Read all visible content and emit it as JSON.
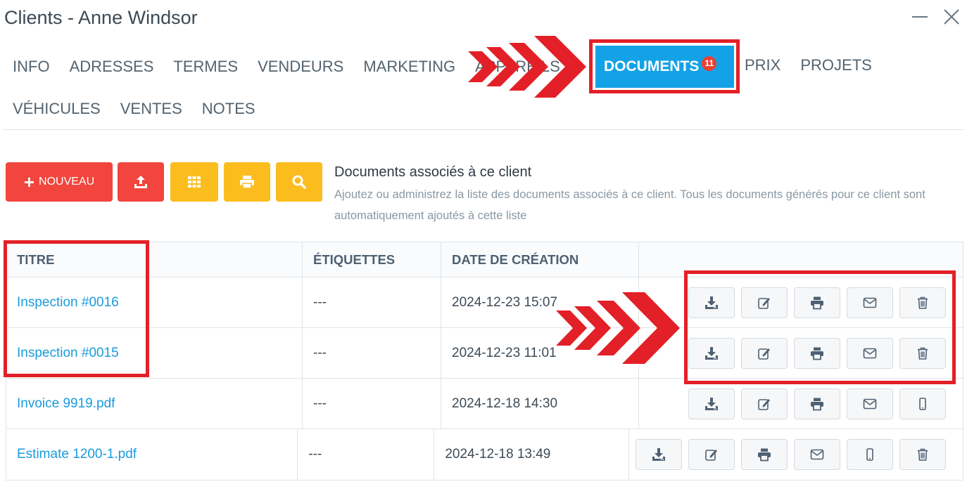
{
  "window": {
    "title": "Clients - Anne Windsor"
  },
  "tabs_row1": [
    "INFO",
    "ADRESSES",
    "TERMES",
    "VENDEURS",
    "MARKETING",
    "APPAREILS"
  ],
  "active_tab": {
    "label": "DOCUMENTS",
    "badge": "11"
  },
  "tabs_after": [
    "PRIX",
    "PROJETS"
  ],
  "tabs_row2": [
    "VÉHICULES",
    "VENTES",
    "NOTES"
  ],
  "toolbar": {
    "new_label": "NOUVEAU"
  },
  "section": {
    "heading": "Documents associés à ce client",
    "description": "Ajoutez ou administrez la liste des documents associés à ce client. Tous les documents générés pour ce client sont automatiquement ajoutés à cette liste"
  },
  "table": {
    "headers": [
      "TITRE",
      "ÉTIQUETTES",
      "DATE DE CRÉATION",
      ""
    ],
    "rows": [
      {
        "title": "Inspection #0016",
        "tags": "---",
        "date": "2024-12-23 15:07",
        "actions": [
          "download-icon",
          "edit-icon",
          "print-icon",
          "email-icon",
          "trash-icon"
        ]
      },
      {
        "title": "Inspection #0015",
        "tags": "---",
        "date": "2024-12-23 11:01",
        "actions": [
          "download-icon",
          "edit-icon",
          "print-icon",
          "email-icon",
          "trash-icon"
        ]
      },
      {
        "title": "Invoice 9919.pdf",
        "tags": "---",
        "date": "2024-12-18 14:30",
        "actions": [
          "download-icon",
          "edit-icon",
          "print-icon",
          "email-icon",
          "mobile-icon"
        ]
      },
      {
        "title": "Estimate 1200-1.pdf",
        "tags": "---",
        "date": "2024-12-18 13:49",
        "actions": [
          "download-icon",
          "edit-icon",
          "print-icon",
          "email-icon",
          "mobile-icon",
          "trash-icon"
        ]
      }
    ]
  },
  "colors": {
    "accent": "#14a2e6",
    "red": "#f1453d",
    "yellow": "#fbbc1d",
    "highlight": "#e32027",
    "badge": "#e84135"
  }
}
